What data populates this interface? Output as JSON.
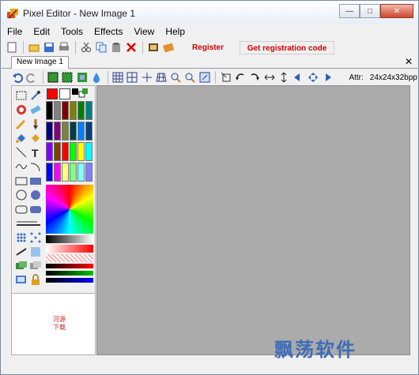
{
  "window": {
    "title": "Pixel Editor - New Image 1"
  },
  "window_buttons": {
    "minimize": "—",
    "maximize": "□",
    "close": "✕"
  },
  "menu": [
    "File",
    "Edit",
    "Tools",
    "Effects",
    "View",
    "Help"
  ],
  "toolbar": {
    "register_label": "Register",
    "get_code_label": "Get registration code"
  },
  "document_tab": {
    "label": "New Image 1",
    "close_glyph": "✕"
  },
  "image_info": {
    "attr_label": "Attr:",
    "attr_value": "24x24x32bpp"
  },
  "thumbnail": {
    "text": "河源\n下载"
  },
  "watermark": "飘荡软件",
  "palette": [
    [
      "#000000",
      "#808080",
      "#800000",
      "#808000",
      "#008000",
      "#008080"
    ],
    [
      "#000080",
      "#800080",
      "#808040",
      "#004040",
      "#0080ff",
      "#004080"
    ],
    [
      "#8000ff",
      "#804000",
      "#ff0000",
      "#00ff00",
      "#ffff00",
      "#00ffff"
    ],
    [
      "#0000ff",
      "#ff00ff",
      "#ffff80",
      "#80ff80",
      "#80ffff",
      "#8080ff"
    ]
  ],
  "colors": {
    "primary": "#ff0000",
    "secondary": "#ffffff",
    "canvas_bg": "#ababab",
    "register_text": "#d00000",
    "watermark": "#3f6db4"
  }
}
